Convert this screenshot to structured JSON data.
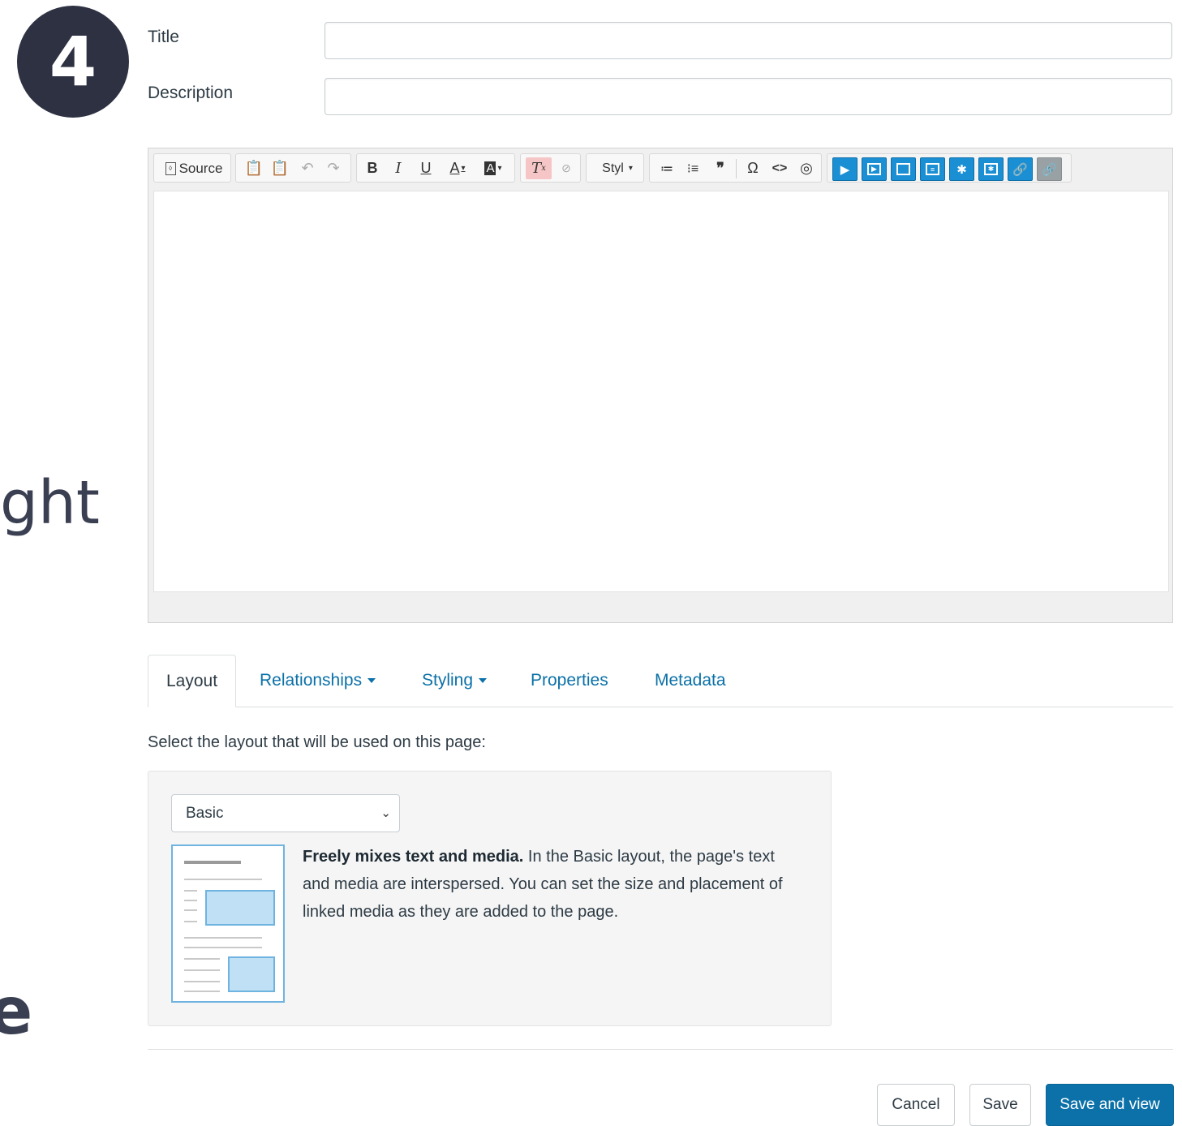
{
  "badge": {
    "number": "4"
  },
  "background_text": {
    "fragment_1": "ght",
    "fragment_2": "e"
  },
  "fields": {
    "title_label": "Title",
    "description_label": "Description",
    "title_value": "",
    "description_value": ""
  },
  "toolbar": {
    "source_label": "Source",
    "styles_label": "Styl",
    "icons": [
      "paste-text-icon",
      "paste-word-icon",
      "undo-icon",
      "redo-icon",
      "bold-icon",
      "italic-icon",
      "underline-icon",
      "text-color-icon",
      "background-color-icon",
      "remove-format-icon",
      "unlink-icon",
      "styles-dropdown",
      "numbered-list-icon",
      "bulleted-list-icon",
      "blockquote-icon",
      "special-char-icon",
      "code-icon",
      "link-globe-icon",
      "media-icons"
    ],
    "glyphs": {
      "bold": "B",
      "italic": "I",
      "underline": "U",
      "text_color": "A",
      "bg_color": "A",
      "omega": "Ω",
      "code": "<>",
      "quote": "❞"
    },
    "accent_color": "#1a8fd4"
  },
  "tabs": [
    {
      "label": "Layout",
      "active": true
    },
    {
      "label": "Relationships",
      "dropdown": true
    },
    {
      "label": "Styling",
      "dropdown": true
    },
    {
      "label": "Properties"
    },
    {
      "label": "Metadata"
    }
  ],
  "layout": {
    "prompt": "Select the layout that will be used on this page:",
    "selected": "Basic",
    "description_bold": "Freely mixes text and media.",
    "description_rest": " In the Basic layout, the page's text and media are interspersed. You can set the size and placement of linked media as they are added to the page."
  },
  "buttons": {
    "cancel": "Cancel",
    "save": "Save",
    "save_and_view": "Save and view"
  },
  "colors": {
    "primary": "#0b71a8",
    "badge": "#2d3142",
    "link": "#0b71a8"
  }
}
